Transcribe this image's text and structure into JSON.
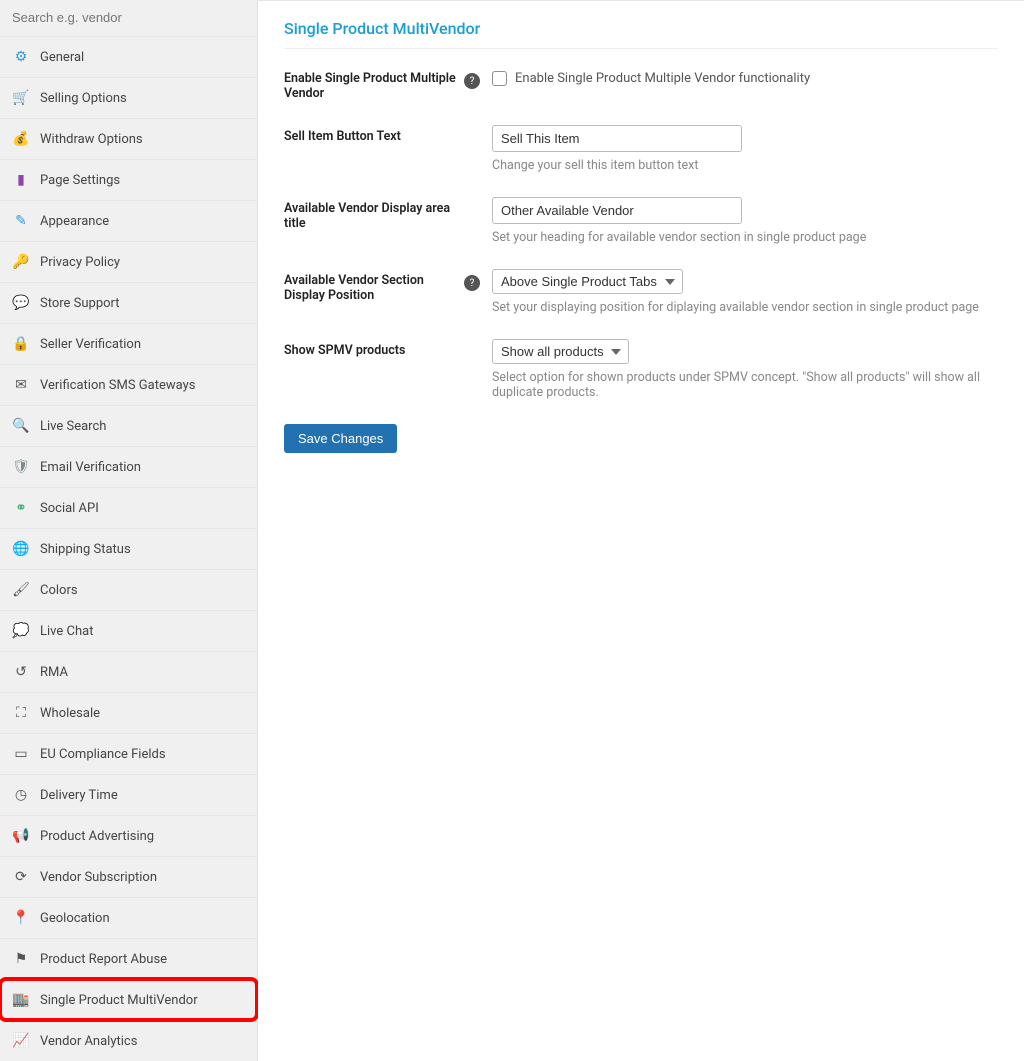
{
  "search": {
    "placeholder": "Search e.g. vendor"
  },
  "sidebar": {
    "items": [
      {
        "label": "General",
        "icon": "gear-icon",
        "color": "i-blue"
      },
      {
        "label": "Selling Options",
        "icon": "cart-icon",
        "color": "i-cyan"
      },
      {
        "label": "Withdraw Options",
        "icon": "money-icon",
        "color": "i-orange"
      },
      {
        "label": "Page Settings",
        "icon": "page-icon",
        "color": "i-purple"
      },
      {
        "label": "Appearance",
        "icon": "brush-icon",
        "color": "i-blue"
      },
      {
        "label": "Privacy Policy",
        "icon": "key-icon",
        "color": "i-grey"
      },
      {
        "label": "Store Support",
        "icon": "chat-icon",
        "color": "i-dark"
      },
      {
        "label": "Seller Verification",
        "icon": "lock-icon",
        "color": "i-grey"
      },
      {
        "label": "Verification SMS Gateways",
        "icon": "mail-icon",
        "color": "i-dark"
      },
      {
        "label": "Live Search",
        "icon": "search-icon",
        "color": "i-dark"
      },
      {
        "label": "Email Verification",
        "icon": "shield-icon",
        "color": "i-grey"
      },
      {
        "label": "Social API",
        "icon": "share-icon",
        "color": "i-green"
      },
      {
        "label": "Shipping Status",
        "icon": "globe-icon",
        "color": "i-dark"
      },
      {
        "label": "Colors",
        "icon": "paint-icon",
        "color": "i-dark"
      },
      {
        "label": "Live Chat",
        "icon": "comment-icon",
        "color": "i-dark"
      },
      {
        "label": "RMA",
        "icon": "undo-icon",
        "color": "i-dark"
      },
      {
        "label": "Wholesale",
        "icon": "boxes-icon",
        "color": "i-dark"
      },
      {
        "label": "EU Compliance Fields",
        "icon": "card-icon",
        "color": "i-dark"
      },
      {
        "label": "Delivery Time",
        "icon": "clock-icon",
        "color": "i-dark"
      },
      {
        "label": "Product Advertising",
        "icon": "megaphone-icon",
        "color": "i-dark"
      },
      {
        "label": "Vendor Subscription",
        "icon": "refresh-icon",
        "color": "i-dark"
      },
      {
        "label": "Geolocation",
        "icon": "pin-icon",
        "color": "i-dark"
      },
      {
        "label": "Product Report Abuse",
        "icon": "flag-icon",
        "color": "i-dark"
      },
      {
        "label": "Single Product MultiVendor",
        "icon": "store-icon",
        "color": "i-dark",
        "highlight": true
      },
      {
        "label": "Vendor Analytics",
        "icon": "chart-icon",
        "color": "i-dark"
      }
    ]
  },
  "page": {
    "title": "Single Product MultiVendor",
    "f1": {
      "label": "Enable Single Product Multiple Vendor",
      "cb": "Enable Single Product Multiple Vendor functionality"
    },
    "f2": {
      "label": "Sell Item Button Text",
      "value": "Sell This Item",
      "desc": "Change your sell this item button text"
    },
    "f3": {
      "label": "Available Vendor Display area title",
      "value": "Other Available Vendor",
      "desc": "Set your heading for available vendor section in single product page"
    },
    "f4": {
      "label": "Available Vendor Section Display Position",
      "value": "Above Single Product Tabs",
      "desc": "Set your displaying position for diplaying available vendor section in single product page"
    },
    "f5": {
      "label": "Show SPMV products",
      "value": "Show all products",
      "desc": "Select option for shown products under SPMV concept. \"Show all products\" will show all duplicate products."
    },
    "save": "Save Changes"
  },
  "iconGlyphs": {
    "gear-icon": "⚙",
    "cart-icon": "🛒",
    "money-icon": "💰",
    "page-icon": "▮",
    "brush-icon": "✎",
    "key-icon": "🔑",
    "chat-icon": "💬",
    "lock-icon": "🔒",
    "mail-icon": "✉",
    "search-icon": "🔍",
    "shield-icon": "🛡",
    "share-icon": "⚭",
    "globe-icon": "🌐",
    "paint-icon": "🖌",
    "comment-icon": "💭",
    "undo-icon": "↺",
    "boxes-icon": "⛶",
    "card-icon": "▭",
    "clock-icon": "◷",
    "megaphone-icon": "📢",
    "refresh-icon": "⟳",
    "pin-icon": "📍",
    "flag-icon": "⚑",
    "store-icon": "🏬",
    "chart-icon": "📈"
  }
}
